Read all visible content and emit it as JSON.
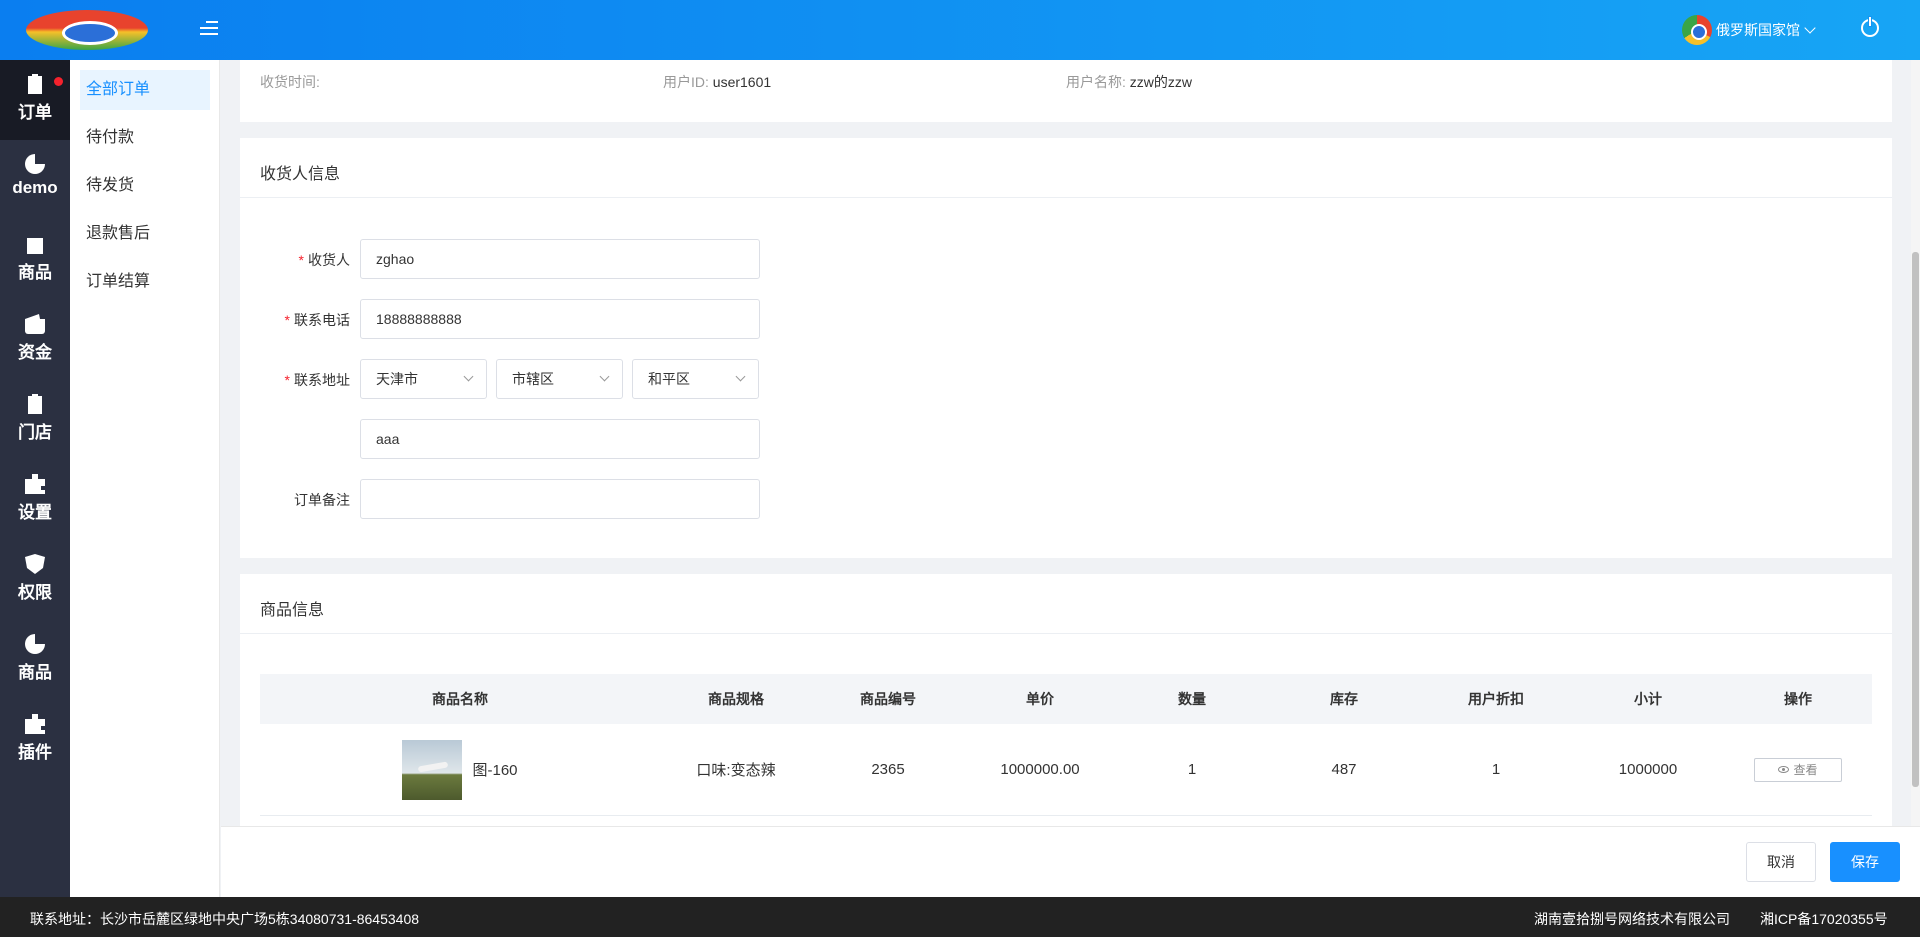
{
  "header": {
    "user_name": "俄罗斯国家馆"
  },
  "rail": {
    "items": [
      {
        "label": "订单",
        "icon": "clipboard-icon"
      },
      {
        "label": "demo",
        "icon": "pie-chart-icon"
      },
      {
        "label": "商品",
        "icon": "shopping-bag-icon"
      },
      {
        "label": "资金",
        "icon": "wallet-icon"
      },
      {
        "label": "门店",
        "icon": "clipboard-icon"
      },
      {
        "label": "设置",
        "icon": "puzzle-icon"
      },
      {
        "label": "权限",
        "icon": "shield-icon"
      },
      {
        "label": "商品",
        "icon": "pie-chart-icon"
      },
      {
        "label": "插件",
        "icon": "puzzle-icon"
      }
    ]
  },
  "submenu": {
    "items": [
      "全部订单",
      "待付款",
      "待发货",
      "退款售后",
      "订单结算"
    ]
  },
  "order_meta": {
    "receive_time_label": "收货时间:",
    "user_id_label": "用户ID:",
    "user_id_value": "user1601",
    "user_name_label": "用户名称:",
    "user_name_value": "zzw的zzw"
  },
  "receiver": {
    "title": "收货人信息",
    "name_label": "收货人",
    "name_value": "zghao",
    "phone_label": "联系电话",
    "phone_value": "18888888888",
    "address_label": "联系地址",
    "province": "天津市",
    "city": "市辖区",
    "district": "和平区",
    "address_detail": "aaa",
    "remark_label": "订单备注",
    "remark_value": ""
  },
  "goods": {
    "title": "商品信息",
    "columns": [
      "商品名称",
      "商品规格",
      "商品编号",
      "单价",
      "数量",
      "库存",
      "用户折扣",
      "小计",
      "操作"
    ],
    "rows": [
      {
        "name": "图-160",
        "spec": "口味:变态辣",
        "code": "2365",
        "price": "1000000.00",
        "qty": "1",
        "stock": "487",
        "discount": "1",
        "subtotal": "1000000",
        "action": "查看"
      }
    ]
  },
  "actions": {
    "cancel": "取消",
    "save": "保存"
  },
  "footer": {
    "address": "联系地址：长沙市岳麓区绿地中央广场5栋34080731-86453408",
    "company": "湖南壹拾捌号网络技术有限公司",
    "icp": "湘ICP备17020355号"
  },
  "colors": {
    "primary": "#1890ff",
    "rail_bg": "#2b3041",
    "header_gradient_start": "#0a7ef0",
    "header_gradient_end": "#17a5f5",
    "required": "#f5222d"
  }
}
